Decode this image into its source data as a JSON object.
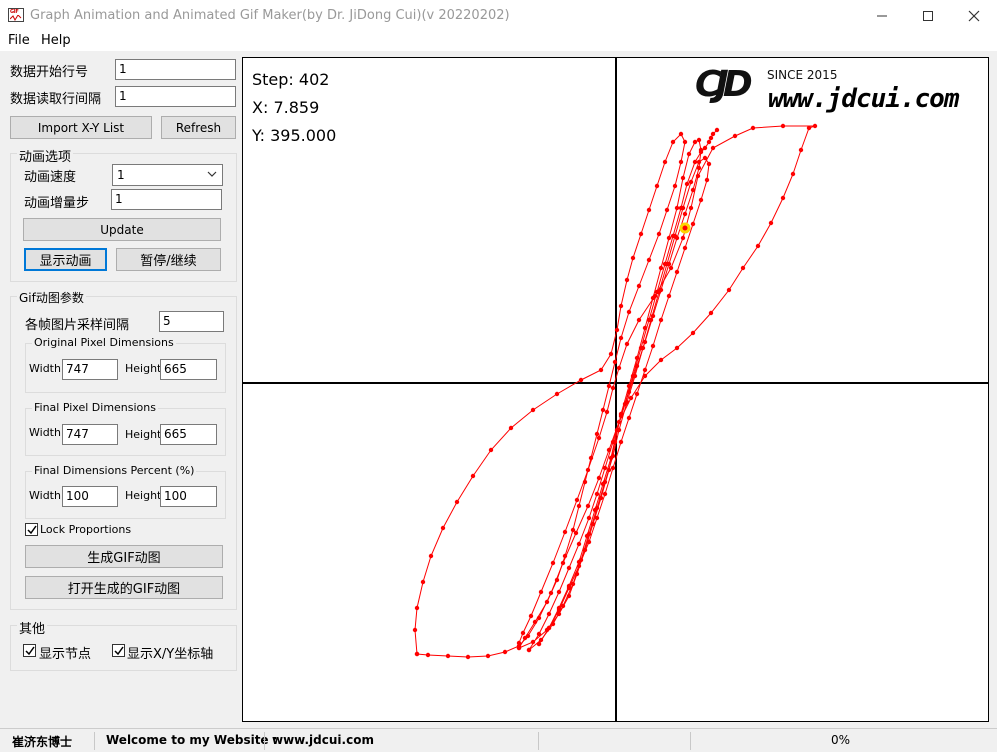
{
  "window": {
    "title": "Graph Animation and Animated Gif Maker(by Dr. JiDong Cui)(v 20220202)",
    "icon": "app-chart-icon",
    "controls": [
      "minimize",
      "maximize",
      "close"
    ]
  },
  "menu": {
    "file": "File",
    "help": "Help"
  },
  "data_settings": {
    "start_row_label": "数据开始行号",
    "start_row_value": "1",
    "row_interval_label": "数据读取行间隔",
    "row_interval_value": "1",
    "import_button": "Import X-Y List",
    "refresh_button": "Refresh"
  },
  "animation_options": {
    "group_title": "动画选项",
    "speed_label": "动画速度",
    "speed_value": "1",
    "increment_label": "动画增量步",
    "increment_value": "1",
    "update_button": "Update",
    "show_animation_button": "显示动画",
    "pause_resume_button": "暂停/继续"
  },
  "gif_params": {
    "group_title": "Gif动图参数",
    "frame_interval_label": "各帧图片采样间隔",
    "frame_interval_value": "5",
    "original": {
      "title": "Original Pixel Dimensions",
      "width_label": "Width",
      "width_value": "747",
      "height_label": "Height",
      "height_value": "665"
    },
    "final": {
      "title": "Final Pixel Dimensions",
      "width_label": "Width",
      "width_value": "747",
      "height_label": "Height",
      "height_value": "665"
    },
    "percent": {
      "title": "Final Dimensions Percent (%)",
      "width_label": "Width",
      "width_value": "100",
      "height_label": "Height",
      "height_value": "100"
    },
    "lock_proportions_label": "Lock Proportions",
    "lock_proportions_checked": true,
    "generate_button": "生成GIF动图",
    "open_button": "打开生成的GIF动图"
  },
  "other": {
    "group_title": "其他",
    "show_nodes_label": "显示节点",
    "show_nodes_checked": true,
    "show_axes_label": "显示X/Y坐标轴",
    "show_axes_checked": true
  },
  "plot": {
    "step_text": "Step: 402",
    "x_text": "X: 7.859",
    "y_text": "Y: 395.000",
    "logo": {
      "letters": "CJD",
      "since": "SINCE 2015",
      "url": "www.jdcui.com"
    },
    "curve_color": "#ff0000",
    "marker_color": "#ffd400",
    "axes_color": "#000000"
  },
  "statusbar": {
    "author": "崔济东博士",
    "welcome": "Welcome to my Website :",
    "website": "www.jdcui.com",
    "progress": "0%"
  }
}
